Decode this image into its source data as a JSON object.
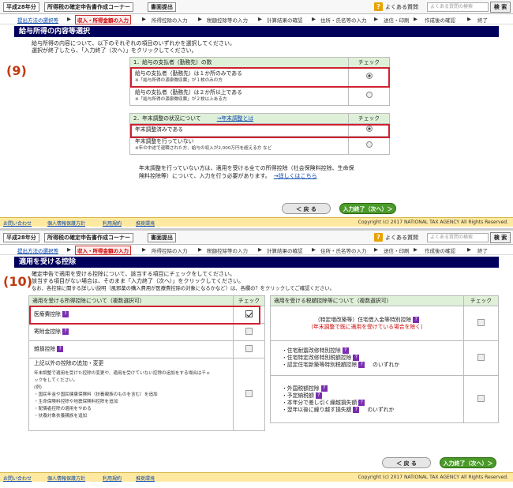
{
  "header": {
    "era_year": "平成28年分",
    "corner_title": "所得税の確定申告書作成コーナー",
    "print_submit": "書面提出",
    "qa_link": "よくある質問",
    "search_placeholder": "よくある質問の検索",
    "search_button": "検 索"
  },
  "steps": [
    "提出方法の選択等",
    "収入・所得金額の入力",
    "所得控除の入力",
    "税額控除等の入力",
    "計算結果の確認",
    "住所・氏名等の入力",
    "送信・印刷",
    "作成後の確認",
    "終了"
  ],
  "panel1": {
    "marker": "(9)",
    "title": "給与所得の内容等選択",
    "instr1": "給与所得の内容について、以下のそれぞれの項目のいずれかを選択してください。",
    "instr2": "選択が終了したら、「入力終了（次へ）」をクリックしてください。",
    "q1_header": "1．給与の支払者（勤務先）の数",
    "q1_check": "チェック",
    "q1_opt1": "給与の支払者（勤務先）は１か所のみである",
    "q1_opt1_sub": "※「給与所得の源泉徴収票」が１枚のみの方",
    "q1_opt2": "給与の支払者（勤務先）は２か所以上である",
    "q1_opt2_sub": "※「給与所得の源泉徴収票」が２枚以上ある方",
    "q2_header": "2．年末調整の状況について",
    "q2_link": "→年末調整とは",
    "q2_check": "チェック",
    "q2_opt1": "年末調整済みである",
    "q2_opt2": "年末調整を行っていない",
    "q2_opt2_sub": "※年の中途で退職された方、給与の収入が2,000万円を超える方 など",
    "note1": "年末調整を行っていない方は、適用を受ける全ての所得控除（社会保険料控除、生命保",
    "note2": "険料控除等）について、入力を行う必要があります。",
    "note_link": "→詳しくはこちら",
    "back": "＜ 戻 る",
    "next": "入力終了（次へ）＞"
  },
  "footer": {
    "contact": "お問い合わせ",
    "privacy": "個人情報保護方針",
    "terms": "利用規約",
    "env": "推奨環境",
    "copyright": "Copyright (c) 2017 NATIONAL TAX AGENCY All Rights Reserved."
  },
  "panel2": {
    "marker": "(10)",
    "title": "適用を受ける控除",
    "instr1": "確定申告で適用を受ける控除について、該当する項目にチェックをしてください。",
    "instr2": "該当する項目がない場合は、そのまま「入力終了（次へ）」をクリックしてください。",
    "instr3": "なお、各控除に関する詳しい説明（風邪薬の購入費用が医療費控除の対象になるかなど）は、各欄の？をクリックしてご確認ください。",
    "left_header": "適用を受ける所得控除について（複数選択可）",
    "left_check": "チェック",
    "medical": "医療費控除",
    "donation": "寄附金控除",
    "casualty": "雑損控除",
    "other_title": "上記以外の控除の追加・変更",
    "other_d1": "年末調整で適用を受けた控除の変更や、適用を受けていない控除の追加をする場合はチェ",
    "other_d2": "ックをしてください。",
    "other_d3": "(例)",
    "other_d4": "・国民年金や国民健康保険料（扶養親族のものを含む）を追加",
    "other_d5": "・生命保険料控除や地震保険料控除を追加",
    "other_d6": "・配偶者控除の適用をやめる",
    "other_d7": "・扶養対象扶養親族を追加",
    "right_header": "適用を受ける税額控除等について（複数選択可）",
    "right_check": "チェック",
    "r1": "（特定増改築等）住宅借入金等特別控除",
    "r1_sub": "（年末調整で既に適用を受けている場合を除く）",
    "r2a": "住宅耐震改修特別控除",
    "r2b": "住宅特定改修特別税額控除",
    "r2c": "認定住宅新築等特別税額控除",
    "r2_either": "のいずれか",
    "r3a": "外国税額控除",
    "r3b": "予定納税額",
    "r3c": "本年分で差し引く繰越損失額",
    "r3d": "翌年以後に繰り越す損失額",
    "r3_either": "のいずれか",
    "back": "＜ 戻 る",
    "next": "入力終了（次へ）＞"
  }
}
